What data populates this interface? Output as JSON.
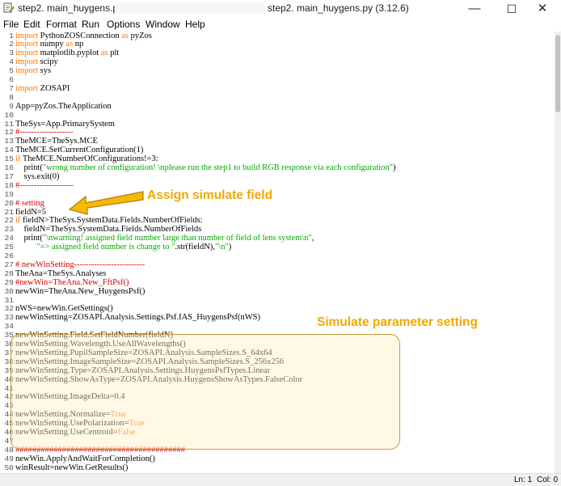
{
  "window": {
    "title_left": "step2. main_huygens.py -",
    "title_right": "step2. main_huygens.py (3.12.6)",
    "minimize_glyph": "—",
    "maximize_glyph": "☐",
    "close_glyph": "✕"
  },
  "menu": [
    "File",
    "Edit",
    "Format",
    "Run",
    "Options",
    "Window",
    "Help"
  ],
  "code": [
    [
      [
        "kw",
        "import"
      ],
      [
        "n",
        " PythonZOSConnection "
      ],
      [
        "kw",
        "as"
      ],
      [
        "n",
        " pyZos"
      ]
    ],
    [
      [
        "kw",
        "import"
      ],
      [
        "n",
        " numpy "
      ],
      [
        "kw",
        "as"
      ],
      [
        "n",
        " np"
      ]
    ],
    [
      [
        "kw",
        "import"
      ],
      [
        "n",
        " matplotlib.pyplot "
      ],
      [
        "kw",
        "as"
      ],
      [
        "n",
        " plt"
      ]
    ],
    [
      [
        "kw",
        "import"
      ],
      [
        "n",
        " scipy"
      ]
    ],
    [
      [
        "kw",
        "import"
      ],
      [
        "n",
        " sys"
      ]
    ],
    [],
    [
      [
        "kw",
        "import"
      ],
      [
        "n",
        " ZOSAPI"
      ]
    ],
    [],
    [
      [
        "n",
        "App=pyZos.TheApplication"
      ]
    ],
    [],
    [
      [
        "n",
        "TheSys=App.PrimarySystem"
      ]
    ],
    [
      [
        "cm",
        "#-------------------"
      ]
    ],
    [
      [
        "n",
        "TheMCE=TheSys.MCE"
      ]
    ],
    [
      [
        "n",
        "TheMCE.SetCurrentConfiguration(1)"
      ]
    ],
    [
      [
        "kw",
        "if"
      ],
      [
        "n",
        " TheMCE.NumberOfConfigurations!=3:"
      ]
    ],
    [
      [
        "n",
        "    print("
      ],
      [
        "str",
        "\"wrong number of configuration! \\nplease run the step1 to build RGB response via each configuration\""
      ],
      [
        "n",
        ")"
      ]
    ],
    [
      [
        "n",
        "    sys.exit(0)"
      ]
    ],
    [
      [
        "cm",
        "#-------------------"
      ]
    ],
    [],
    [
      [
        "cm",
        "# setting"
      ]
    ],
    [
      [
        "n",
        "fieldN=5"
      ]
    ],
    [
      [
        "kw",
        "if"
      ],
      [
        "n",
        " fieldN>TheSys.SystemData.Fields.NumberOfFields:"
      ]
    ],
    [
      [
        "n",
        "    fieldN=TheSys.SystemData.Fields.NumberOfFields"
      ]
    ],
    [
      [
        "n",
        "    print("
      ],
      [
        "str",
        "\"\\nwarning! assigned field number large than number of field of lens system\\n\""
      ],
      [
        "n",
        ","
      ]
    ],
    [
      [
        "str",
        "          \"=> assigned field number is change to \""
      ],
      [
        "n",
        ".str(fieldN),"
      ],
      [
        "str",
        "\"\\n\""
      ],
      [
        "n",
        ")"
      ]
    ],
    [],
    [
      [
        "cm",
        "# newWinSetting-------------------------"
      ]
    ],
    [
      [
        "n",
        "TheAna=TheSys.Analyses"
      ]
    ],
    [
      [
        "cm",
        "#newWin=TheAna.New_FftPsf()"
      ]
    ],
    [
      [
        "n",
        "newWin=TheAna.New_HuygensPsf()"
      ]
    ],
    [],
    [
      [
        "n",
        "nWS=newWin.GetSettings()"
      ]
    ],
    [
      [
        "n",
        "newWinSetting=ZOSAPI.Analysis.Settings.Psf.IAS_HuygensPsf(nWS)"
      ]
    ],
    [],
    [
      [
        "n",
        "newWinSetting.Field.SetFieldNumber(fieldN)"
      ]
    ],
    [
      [
        "n",
        "newWinSetting.Wavelength.UseAllWavelengths()"
      ]
    ],
    [
      [
        "n",
        "newWinSetting.PupilSampleSize=ZOSAPI.Analysis.SampleSizes.S_64x64"
      ]
    ],
    [
      [
        "n",
        "newWinSetting.ImageSampleSize=ZOSAPI.Analysis.SampleSizes.S_256x256"
      ]
    ],
    [
      [
        "n",
        "newWinSetting.Type=ZOSAPI.Analysis.Settings.HuygensPsfTypes.Linear"
      ]
    ],
    [
      [
        "n",
        "newWinSetting.ShowAsType=ZOSAPI.Analysis.HuygensShowAsTypes.FalseColor"
      ]
    ],
    [],
    [
      [
        "n",
        "newWinSetting.ImageDelta=0.4"
      ]
    ],
    [],
    [
      [
        "n",
        "newWinSetting.Normalize="
      ],
      [
        "kw",
        "True"
      ]
    ],
    [
      [
        "n",
        "newWinSetting.UsePolarization="
      ],
      [
        "kw",
        "True"
      ]
    ],
    [
      [
        "n",
        "newWinSetting.UseCentroid="
      ],
      [
        "kw",
        "False"
      ]
    ],
    [],
    [
      [
        "cm",
        "########################################"
      ]
    ],
    [
      [
        "n",
        "newWin.ApplyAndWaitForCompletion()"
      ]
    ],
    [
      [
        "n",
        "winResult=newWin.GetResults()"
      ]
    ]
  ],
  "annotations": {
    "field_label": "Assign simulate field",
    "param_label": "Simulate parameter setting",
    "accent_color": "#f2a900"
  },
  "status": {
    "line": "Ln: 1",
    "col": "Col: 0"
  }
}
